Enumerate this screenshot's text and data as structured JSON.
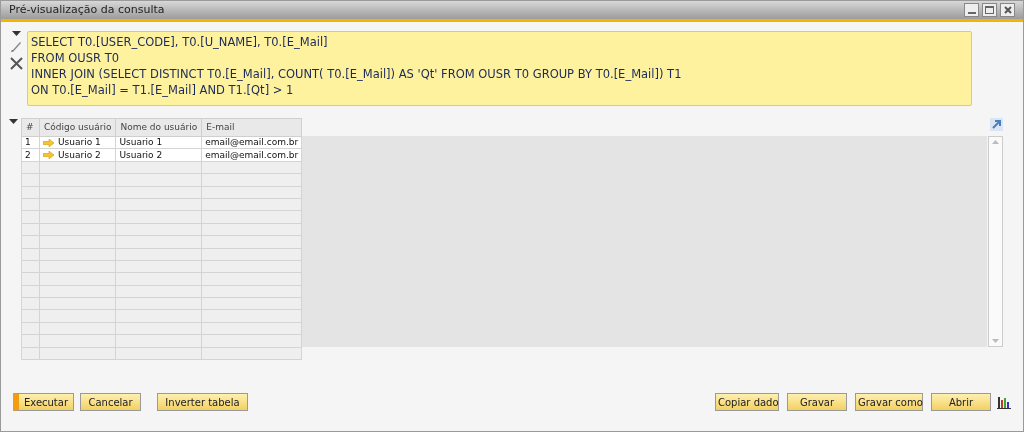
{
  "window": {
    "title": "Pré-visualização da consulta"
  },
  "query": {
    "lines": [
      "SELECT T0.[USER_CODE], T0.[U_NAME], T0.[E_Mail]",
      "FROM OUSR T0",
      "INNER JOIN (SELECT DISTINCT T0.[E_Mail], COUNT( T0.[E_Mail]) AS 'Qt' FROM OUSR T0 GROUP BY T0.[E_Mail]) T1",
      "ON T0.[E_Mail] = T1.[E_Mail] AND T1.[Qt] > 1"
    ]
  },
  "table": {
    "columns": [
      "#",
      "Código usuário",
      "Nome do usuário",
      "E-mail"
    ],
    "rows": [
      {
        "cells": [
          "1",
          "Usuario 1",
          "Usuario 1",
          "email@email.com.br"
        ]
      },
      {
        "cells": [
          "2",
          "Usuario 2",
          "Usuario 2",
          "email@email.com.br"
        ]
      }
    ]
  },
  "buttons_left": [
    {
      "label": "Executar",
      "default": true
    },
    {
      "label": "Cancelar",
      "default": false
    },
    {
      "label": "Inverter tabela",
      "default": false
    }
  ],
  "buttons_right": [
    {
      "label": "Copiar dado",
      "default": false
    },
    {
      "label": "Gravar",
      "default": false
    },
    {
      "label": "Gravar como",
      "default": false
    },
    {
      "label": "Abrir",
      "default": false
    }
  ]
}
